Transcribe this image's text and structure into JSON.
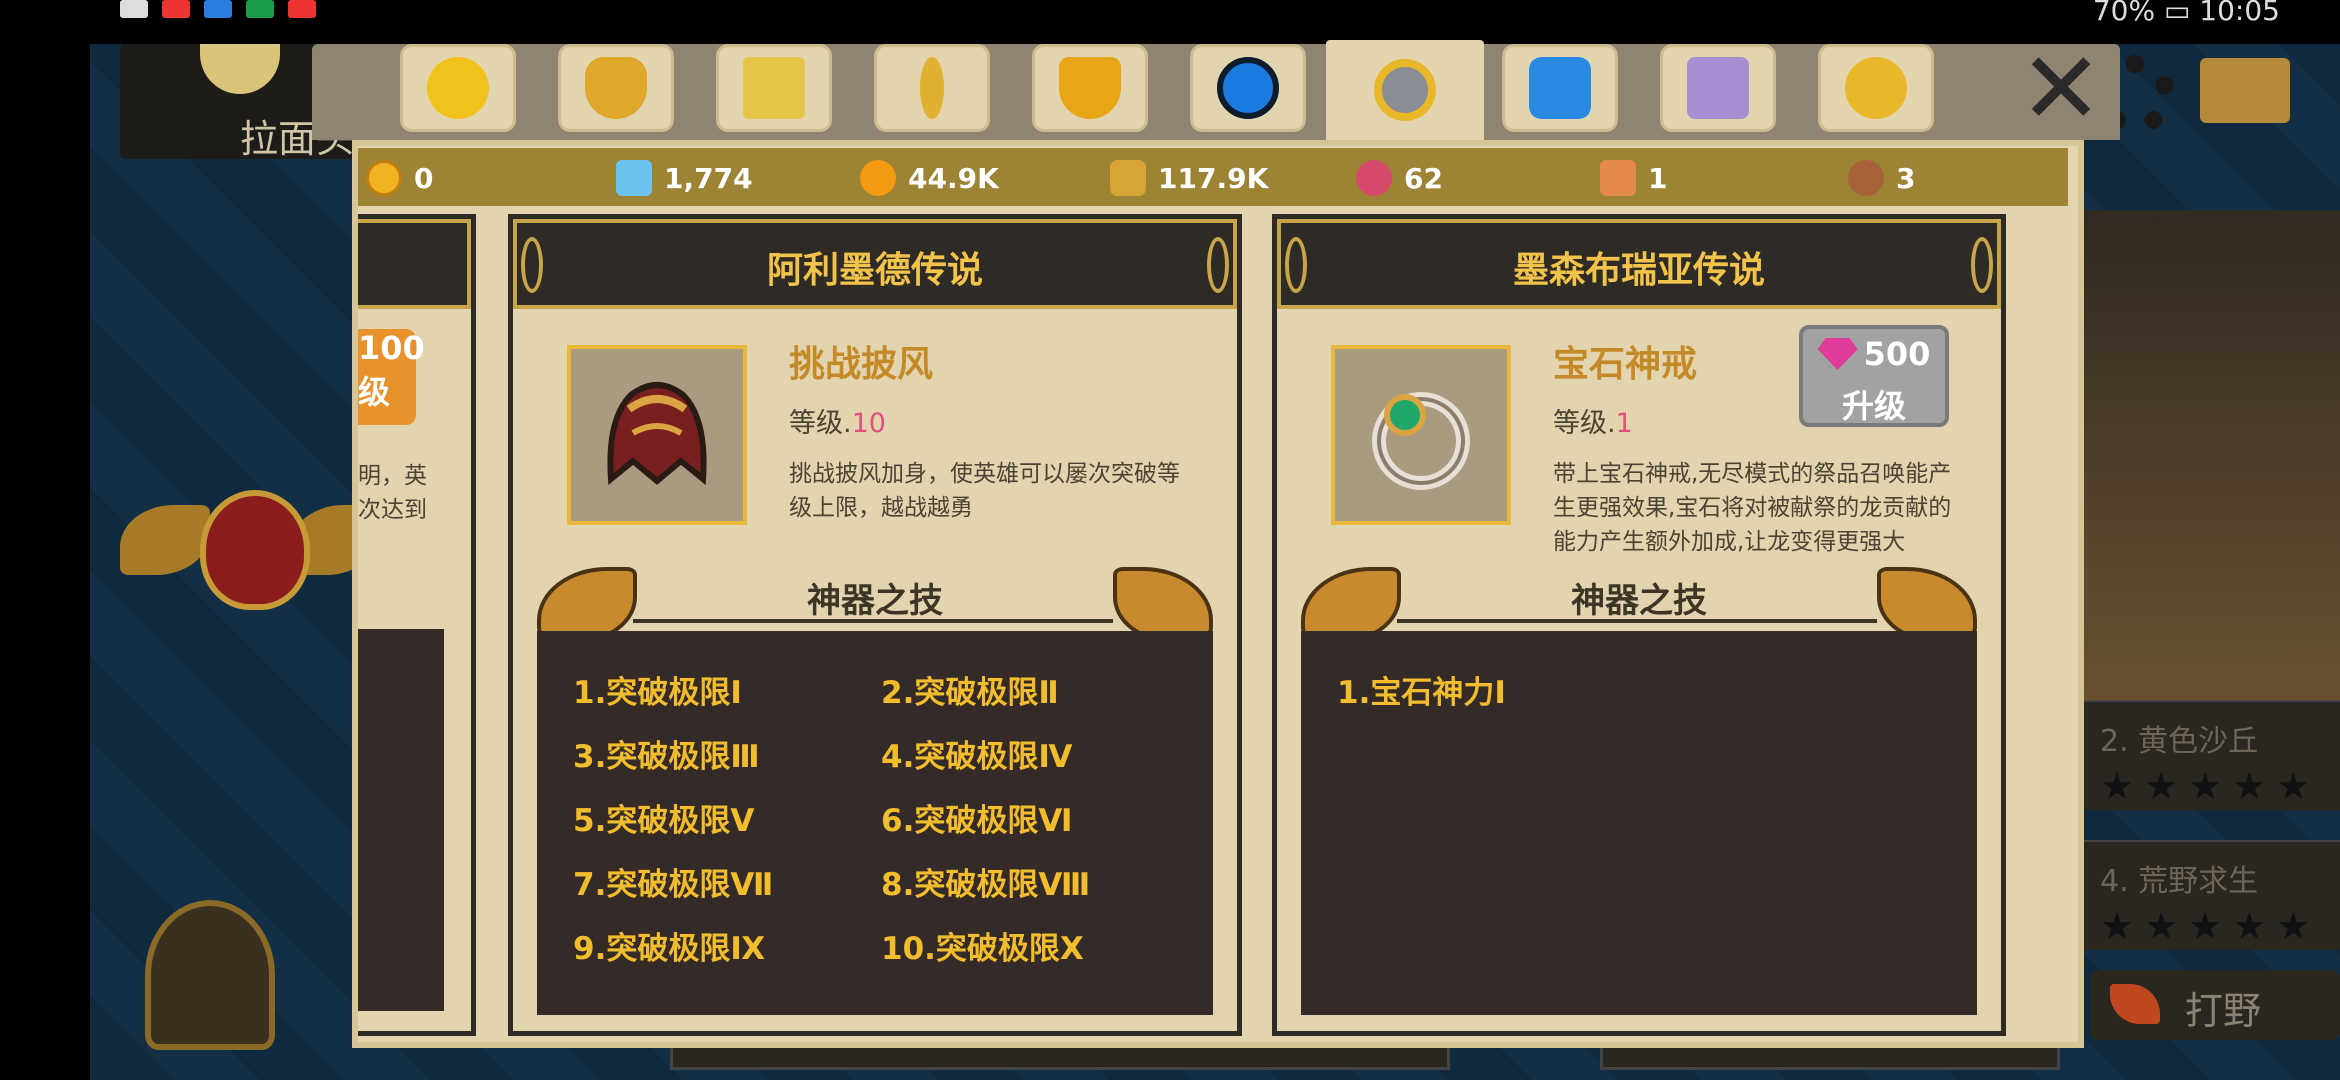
{
  "status_bar": {
    "right_text": "70% ▭ 10:05"
  },
  "background": {
    "player_name_partial": "拉面头",
    "right_rows": [
      "2. 黄色沙丘",
      "4. 荒野求生"
    ],
    "hunt_label": "打野"
  },
  "tabs": [
    {
      "icon": "hero-icon",
      "color": "#f2c21c"
    },
    {
      "icon": "dragon-head-icon",
      "color": "#e0a82a"
    },
    {
      "icon": "shop-icon",
      "color": "#e6c64a"
    },
    {
      "icon": "key-icon",
      "color": "#e0b030"
    },
    {
      "icon": "trophy-icon",
      "color": "#e8a617"
    },
    {
      "icon": "orb-icon",
      "color": "#1a7be0"
    },
    {
      "icon": "artifact-icon",
      "color": "#8a8c96",
      "active": true
    },
    {
      "icon": "gem-icon",
      "color": "#2a8ae3"
    },
    {
      "icon": "shirt-icon",
      "color": "#a68fd1"
    },
    {
      "icon": "friends-icon",
      "color": "#e8b82a"
    }
  ],
  "currencies": [
    {
      "icon": "gold-coin-icon",
      "value": "0",
      "color": "#f0b321"
    },
    {
      "icon": "diamond-icon",
      "value": "1,774",
      "color": "#6cc3ef"
    },
    {
      "icon": "orange-orb-icon",
      "value": "44.9K",
      "color": "#f39a12"
    },
    {
      "icon": "star-shard-icon",
      "value": "117.9K",
      "color": "#d6a437"
    },
    {
      "icon": "dragon-egg-icon",
      "value": "62",
      "color": "#d64b6c"
    },
    {
      "icon": "scroll-icon",
      "value": "1",
      "color": "#e58a4a"
    },
    {
      "icon": "medal-icon",
      "value": "3",
      "color": "#a8623a"
    }
  ],
  "left_card": {
    "button_text_1": "100",
    "button_text_2": "级",
    "desc": "明，英次达到"
  },
  "card_1": {
    "title": "阿利墨德传说",
    "item_name": "挑战披风",
    "level_label": "等级.",
    "level_value": "10",
    "desc": "挑战披风加身，使英雄可以屡次突破等级上限，越战越勇",
    "skills_title": "神器之技",
    "skills": [
      "1.突破极限Ⅰ",
      "2.突破极限Ⅱ",
      "3.突破极限Ⅲ",
      "4.突破极限Ⅳ",
      "5.突破极限Ⅴ",
      "6.突破极限Ⅵ",
      "7.突破极限Ⅶ",
      "8.突破极限Ⅷ",
      "9.突破极限Ⅸ",
      "10.突破极限Ⅹ"
    ]
  },
  "card_2": {
    "title": "墨森布瑞亚传说",
    "item_name": "宝石神戒",
    "level_label": "等级.",
    "level_value": "1",
    "desc": "带上宝石神戒,无尽模式的祭品召唤能产生更强效果,宝石将对被献祭的龙贡献的能力产生额外加成,让龙变得更强大",
    "upgrade_cost": "500",
    "upgrade_label": "升级",
    "skills_title": "神器之技",
    "skills": [
      "1.宝石神力Ⅰ"
    ]
  }
}
